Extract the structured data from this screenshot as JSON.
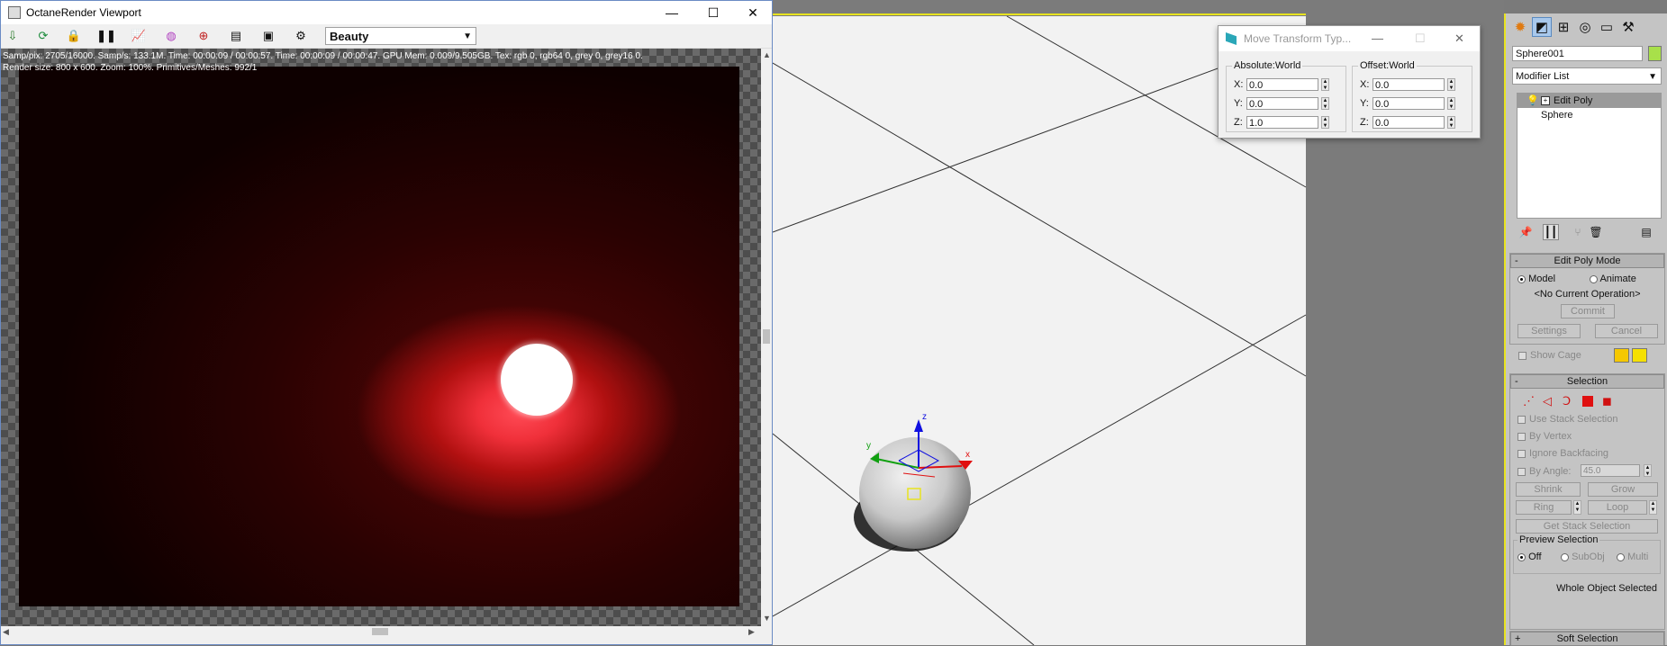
{
  "octane": {
    "title": "OctaneRender Viewport",
    "pass": "Beauty",
    "stats_line1": "Samp/pix: 2705/16000.   Samp/s: 133.1M.   Time: 00:00:09 / 00:00:57.   Time: 00:00:09 / 00:00:47.   GPU Mem: 0.009/9.505GB.   Tex: rgb 0, rgb64 0, grey 0, grey16 0.",
    "stats_line2": "Render size: 800 x 600.   Zoom: 100%.   Primitives/Meshes: 992/1",
    "window_controls": {
      "minimize": "—",
      "maximize": "☐",
      "close": "✕"
    },
    "toolbar_icons": [
      "save-icon",
      "refresh-icon",
      "lock-icon",
      "pause-icon",
      "stats-icon",
      "color-picker-icon",
      "region-icon",
      "film-icon",
      "camera-icon",
      "settings-icon"
    ]
  },
  "dialog": {
    "title": "Move Transform Typ...",
    "absolute_label": "Absolute:World",
    "offset_label": "Offset:World",
    "absolute": {
      "x_label": "X:",
      "y_label": "Y:",
      "z_label": "Z:",
      "x": "0.0",
      "y": "0.0",
      "z": "1.0"
    },
    "offset": {
      "x_label": "X:",
      "y_label": "Y:",
      "z_label": "Z:",
      "x": "0.0",
      "y": "0.0",
      "z": "0.0"
    }
  },
  "viewport": {
    "gizmo": {
      "x_label": "x",
      "y_label": "y",
      "z_label": "z"
    },
    "colors": {
      "x_axis": "#e01010",
      "y_axis": "#10a010",
      "z_axis": "#1010e0",
      "floor": "#f2f2f2",
      "panel_accent": "#e8e320"
    }
  },
  "cmd": {
    "object_name": "Sphere001",
    "modifier_list": "Modifier List",
    "stack": [
      {
        "label": "Edit Poly",
        "selected": true
      },
      {
        "label": "Sphere",
        "selected": false
      }
    ],
    "edit_poly_mode": {
      "title": "Edit Poly Mode",
      "model": "Model",
      "animate": "Animate",
      "current_op": "<No Current Operation>",
      "commit": "Commit",
      "settings": "Settings",
      "cancel": "Cancel",
      "show_cage": "Show Cage"
    },
    "selection": {
      "title": "Selection",
      "use_stack": "Use Stack Selection",
      "by_vertex": "By Vertex",
      "ignore_backfacing": "Ignore Backfacing",
      "by_angle": "By Angle:",
      "angle_value": "45.0",
      "shrink": "Shrink",
      "grow": "Grow",
      "ring": "Ring",
      "loop": "Loop",
      "get_stack": "Get Stack Selection",
      "preview_label": "Preview Selection",
      "off": "Off",
      "subobj": "SubObj",
      "multi": "Multi",
      "status": "Whole Object Selected"
    },
    "soft_selection": {
      "title": "Soft Selection"
    }
  }
}
